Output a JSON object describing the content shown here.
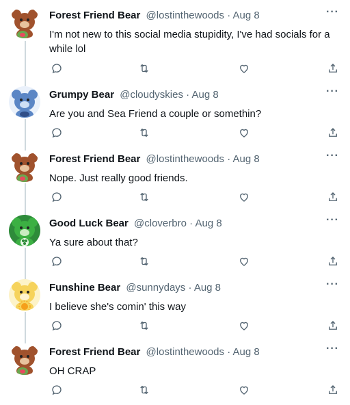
{
  "tweets": [
    {
      "name": "Forest Friend Bear",
      "handle": "@lostinthewoods",
      "date": "Aug 8",
      "text": "I'm not new to this social media stupidity, I've had socials for a while lol",
      "avatar": "forest-friend-bear",
      "avatar_color": "#a0522d"
    },
    {
      "name": "Grumpy Bear",
      "handle": "@cloudyskies",
      "date": "Aug 8",
      "text": "Are you and Sea Friend a couple or somethin?",
      "avatar": "grumpy-bear",
      "avatar_color": "#5b86c5"
    },
    {
      "name": "Forest Friend Bear",
      "handle": "@lostinthewoods",
      "date": "Aug 8",
      "text": "Nope. Just really good friends.",
      "avatar": "forest-friend-bear",
      "avatar_color": "#a0522d"
    },
    {
      "name": "Good Luck Bear",
      "handle": "@cloverbro",
      "date": "Aug 8",
      "text": "Ya sure about that?",
      "avatar": "good-luck-bear",
      "avatar_color": "#3cb043"
    },
    {
      "name": "Funshine Bear",
      "handle": "@sunnydays",
      "date": "Aug 8",
      "text": "I believe she's comin' this way",
      "avatar": "funshine-bear",
      "avatar_color": "#f6d35b"
    },
    {
      "name": "Forest Friend Bear",
      "handle": "@lostinthewoods",
      "date": "Aug 8",
      "text": "OH CRAP",
      "avatar": "forest-friend-bear",
      "avatar_color": "#a0522d"
    }
  ],
  "separator": "·",
  "more_label": "···",
  "icons": {
    "reply": "reply-icon",
    "retweet": "retweet-icon",
    "like": "like-icon",
    "share": "share-icon"
  }
}
